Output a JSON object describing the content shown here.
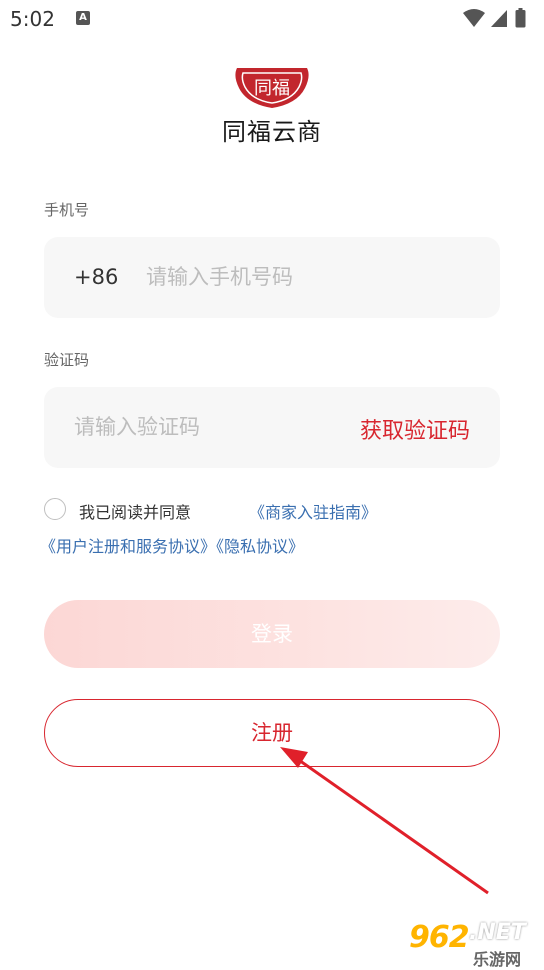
{
  "status_bar": {
    "time": "5:02",
    "notification_icon": "A"
  },
  "logo": {
    "seal_text": "同福",
    "brand_name": "同福云商"
  },
  "phone": {
    "label": "手机号",
    "country_code": "+86",
    "placeholder": "请输入手机号码"
  },
  "code": {
    "label": "验证码",
    "placeholder": "请输入验证码",
    "get_code_label": "获取验证码"
  },
  "agreement": {
    "prefix_text": "我已阅读并同意",
    "merchant_guide": "《商家入驻指南》",
    "user_agreement": "《用户注册和服务协议》",
    "privacy_agreement": "《隐私协议》"
  },
  "buttons": {
    "login_label": "登录",
    "register_label": "注册"
  },
  "watermark": {
    "number": "962",
    "suffix": ".NET",
    "cn": "乐游网"
  },
  "colors": {
    "accent_red": "#d8262f",
    "link_blue": "#3a6fb0",
    "login_pink": "#fcd7d5"
  }
}
